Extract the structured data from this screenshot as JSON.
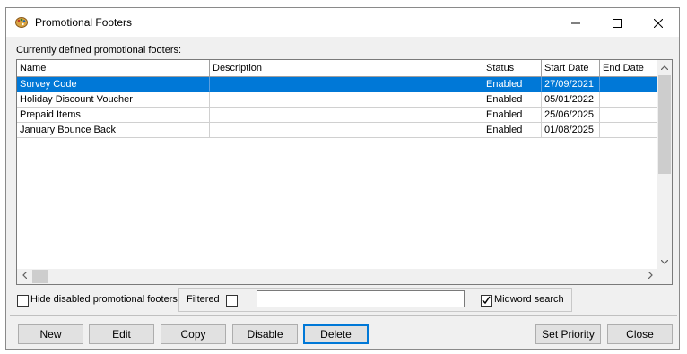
{
  "window": {
    "title": "Promotional Footers",
    "icon": "palette-icon"
  },
  "list_caption": "Currently defined promotional footers:",
  "table": {
    "columns": [
      "Name",
      "Description",
      "Status",
      "Start Date",
      "End Date"
    ],
    "rows": [
      {
        "name": "Survey Code",
        "description": "",
        "status": "Enabled",
        "start_date": "27/09/2021",
        "end_date": "",
        "selected": true
      },
      {
        "name": "Holiday Discount Voucher",
        "description": "",
        "status": "Enabled",
        "start_date": "05/01/2022",
        "end_date": "",
        "selected": false
      },
      {
        "name": "Prepaid Items",
        "description": "",
        "status": "Enabled",
        "start_date": "25/06/2025",
        "end_date": "",
        "selected": false
      },
      {
        "name": "January Bounce Back",
        "description": "",
        "status": "Enabled",
        "start_date": "01/08/2025",
        "end_date": "",
        "selected": false
      }
    ]
  },
  "options": {
    "hide_disabled_label": "Hide disabled promotional footers",
    "hide_disabled_checked": false,
    "filtered_label": "Filtered",
    "filtered_checked": false,
    "filter_text": "",
    "midword_label": "Midword search",
    "midword_checked": true
  },
  "buttons": {
    "new": "New",
    "edit": "Edit",
    "copy": "Copy",
    "disable": "Disable",
    "delete": "Delete",
    "set_priority": "Set Priority",
    "close": "Close"
  },
  "colors": {
    "selection": "#0078d7",
    "window_bg": "#f0f0f0"
  }
}
